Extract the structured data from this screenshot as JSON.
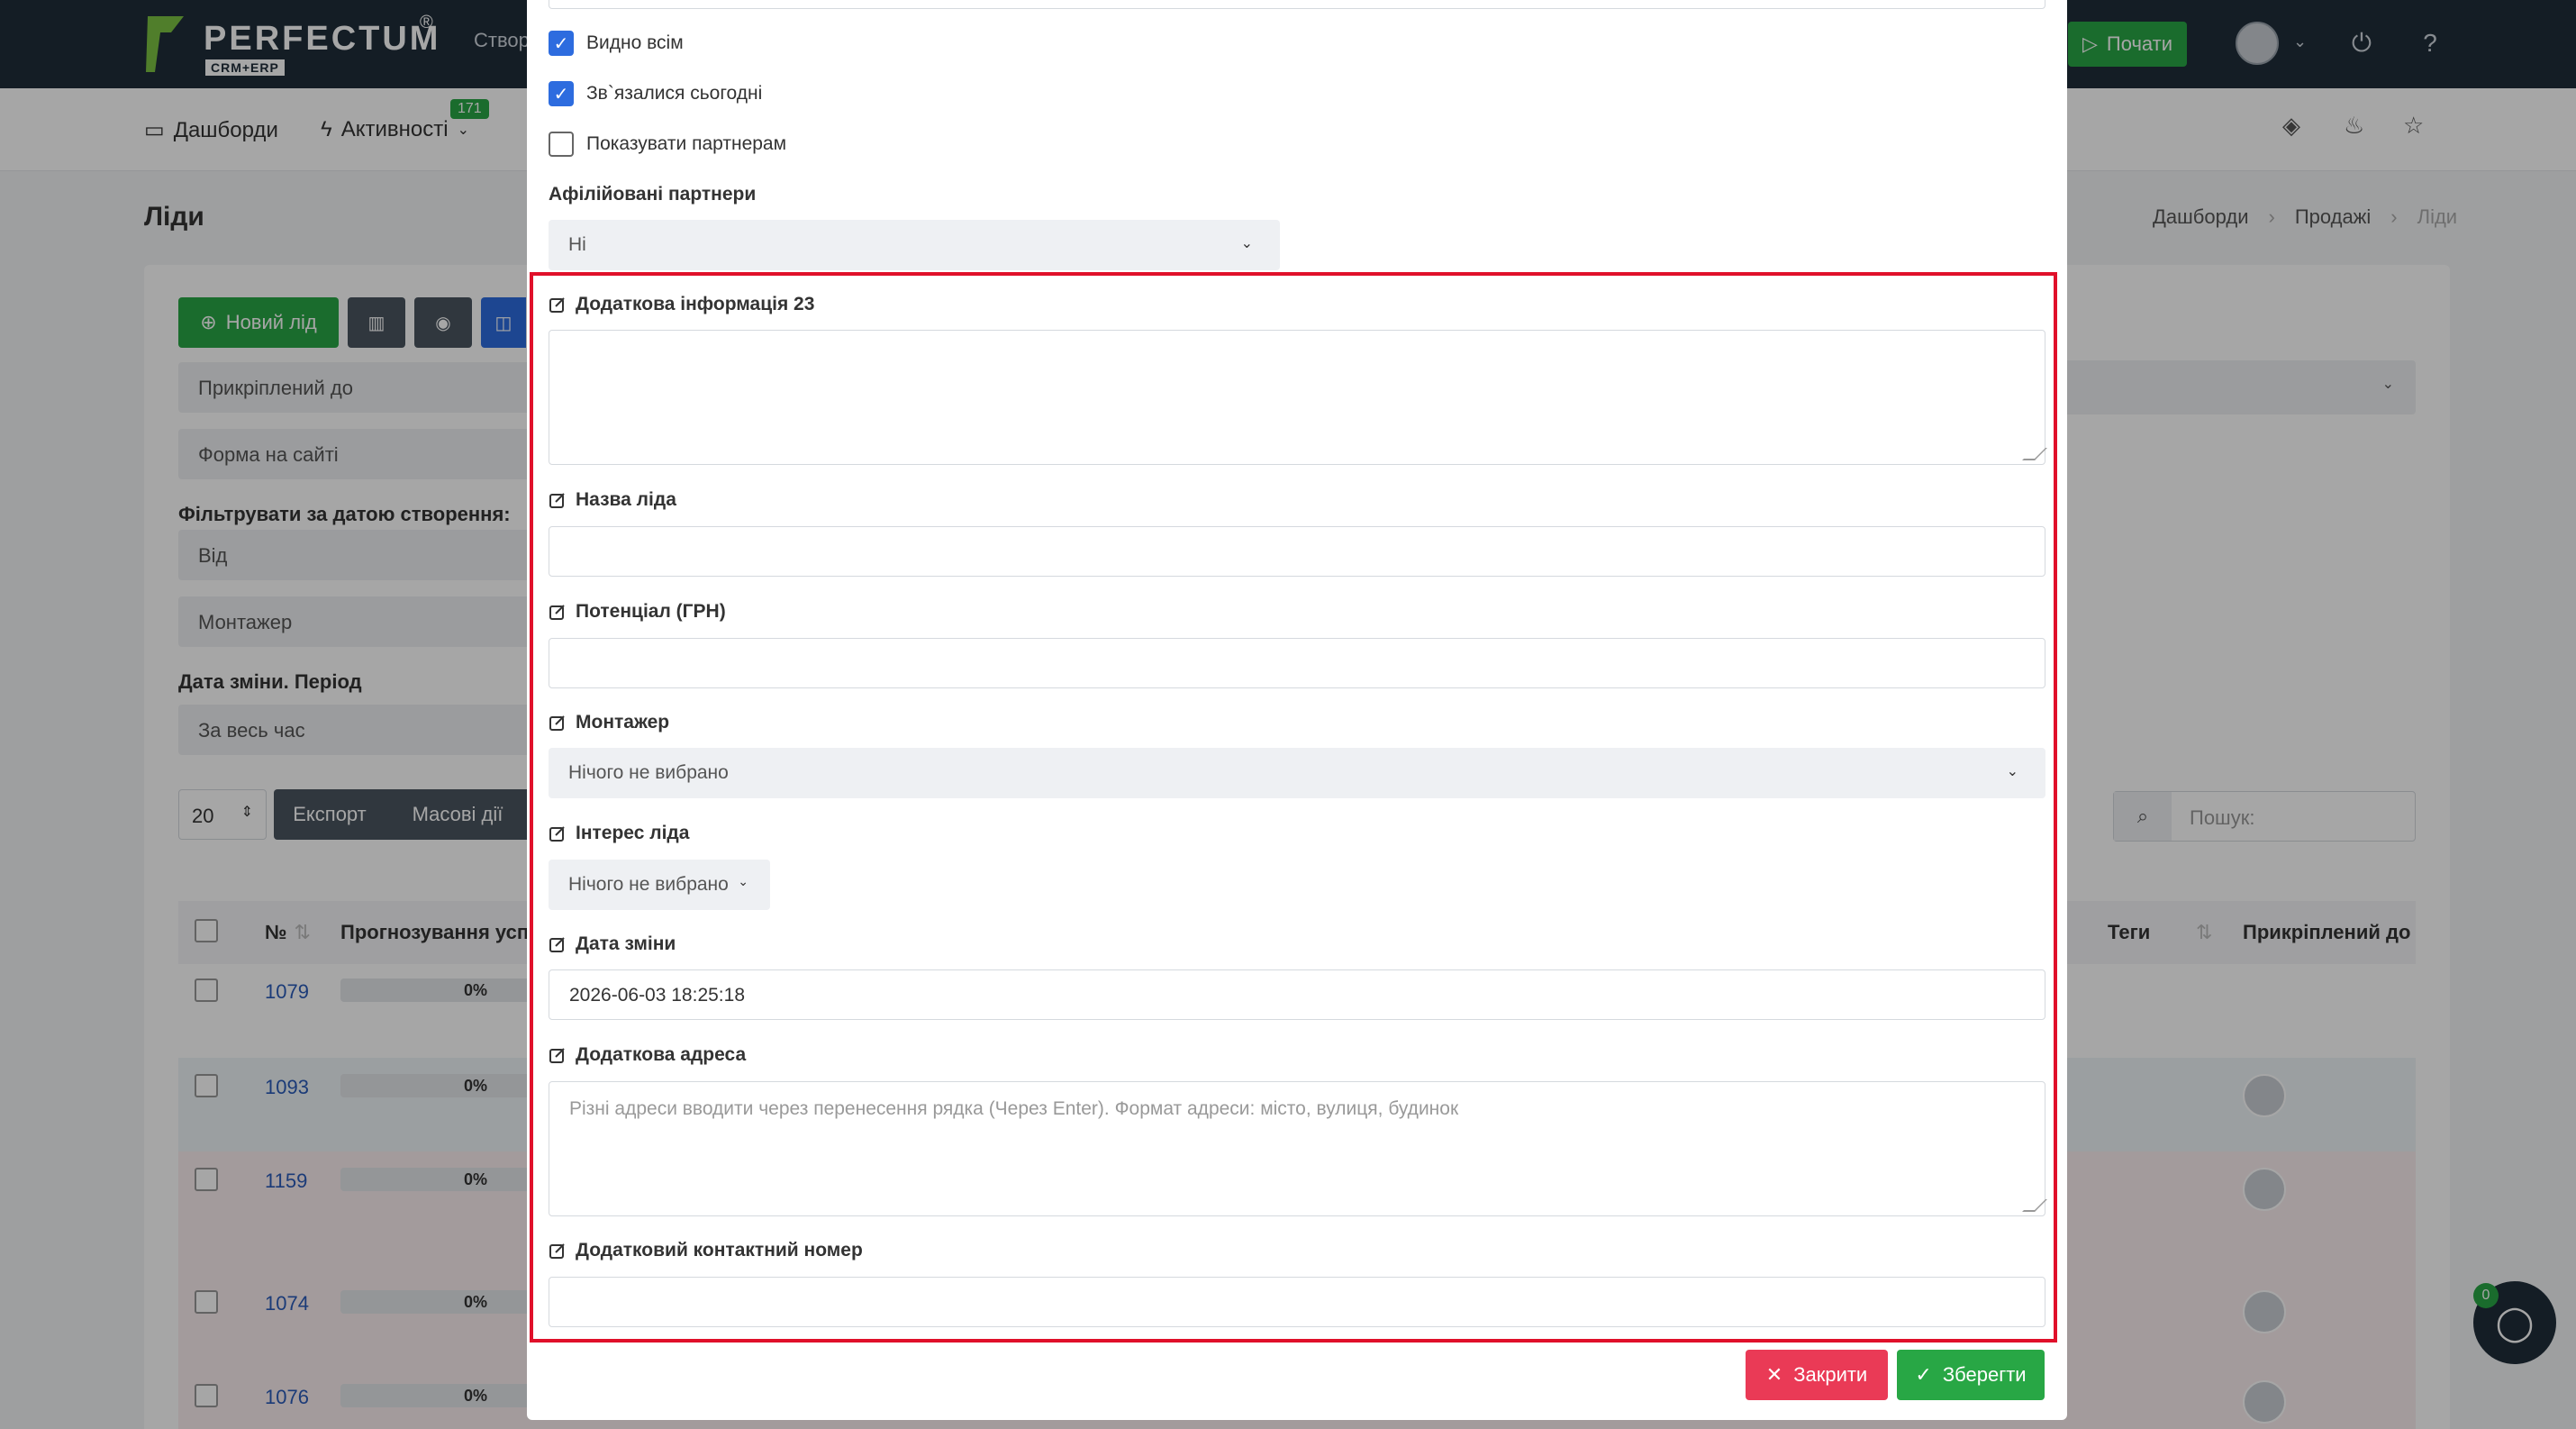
{
  "topbar": {
    "logo_text": "PERFECTUM",
    "logo_sub": "CRM+ERP",
    "logo_reg": "®",
    "create_label": "Створ",
    "start_label": "Почати",
    "icons": [
      "power-icon",
      "help-icon"
    ]
  },
  "nav": {
    "dashboards": "Дашборди",
    "activities": "Активності",
    "activities_badge": "171"
  },
  "page": {
    "title": "Ліди",
    "breadcrumb": [
      "Дашборди",
      "Продажі",
      "Ліди"
    ]
  },
  "toolbar": {
    "new_lead": "Новий лід",
    "export": "Експорт",
    "bulk": "Масові дії",
    "per_page": "20",
    "search_placeholder": "Пошук:"
  },
  "filters": {
    "attached_to": "Прикріплений до",
    "site_form": "Форма на сайті",
    "created_date_label": "Фільтрувати за датою створення:",
    "from": "Від",
    "installer": "Монтажер",
    "change_date_label": "Дата зміни. Період",
    "all_time": "За весь час"
  },
  "table": {
    "headers": {
      "num": "№",
      "forecast": "Прогнозування успі",
      "tags": "Теги",
      "attached": "Прикріплений до"
    },
    "rows": [
      {
        "id": "1079",
        "progress": "0%"
      },
      {
        "id": "1093",
        "progress": "0%"
      },
      {
        "id": "1159",
        "progress": "0%"
      },
      {
        "id": "1074",
        "progress": "0%"
      },
      {
        "id": "1076",
        "progress": "0%"
      }
    ]
  },
  "chat": {
    "badge": "0"
  },
  "modal": {
    "checkbox_visible_all": "Видно всім",
    "checkbox_contacted_today": "Зв`язалися сьогодні",
    "checkbox_show_partners": "Показувати партнерам",
    "affiliated_label": "Афілійовані партнери",
    "affiliated_value": "Ні",
    "extra_info_label": "Додаткова інформація 23",
    "lead_name_label": "Назва ліда",
    "potential_label": "Потенціал (ГРН)",
    "installer_label": "Монтажер",
    "installer_value": "Нічого не вибрано",
    "interest_label": "Інтерес ліда",
    "interest_value": "Нічого не вибрано",
    "change_date_label": "Дата зміни",
    "change_date_value": "2026-06-03 18:25:18",
    "extra_address_label": "Додаткова адреса",
    "extra_address_placeholder": "Різні адреси вводити через перенесення рядка (Через Enter). Формат адреси: місто, вулиця, будинок",
    "extra_phone_label": "Додатковий контактний номер",
    "close_button": "Закрити",
    "save_button": "Зберегти"
  },
  "colors": {
    "accent_green": "#28a745",
    "accent_blue": "#2d6cdf",
    "danger": "#ea3a56",
    "highlight_red": "#e0102a",
    "topbar": "#1f2d3a"
  }
}
